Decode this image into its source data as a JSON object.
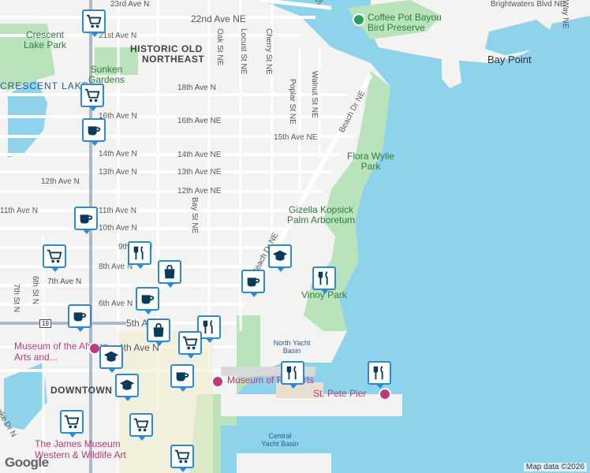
{
  "map": {
    "colors": {
      "water": "#8ed3ec",
      "park": "#b9e3bb",
      "land": "#f3f3f1",
      "road": "#ffffff",
      "marker_border": "#2b8ad6",
      "poi": "#c0397d"
    },
    "districts": [
      "HISTORIC OLD",
      "NORTHEAST",
      "DOWNTOWN"
    ],
    "parks": [
      "Crescent Lake Park",
      "Sunken Gardens",
      "Flora Wylie Park",
      "Gizella Kopsick Palm Arboretum",
      "Vinoy Park",
      "Coffee Pot Bayou Bird Preserve"
    ],
    "water": [
      "CRESCENT LAKE",
      "North Yacht Basin",
      "Central Yacht Basin"
    ],
    "places": [
      "Bay Point",
      "Museum of the African Arts and...",
      "Museum of Fine Arts",
      "St. Pete Pier",
      "The James Museum Western & Wildlife Art"
    ],
    "roads": {
      "horizontal": [
        "23rd Ave N",
        "22nd Ave NE",
        "21st Ave N",
        "18th Ave N",
        "16th Ave N",
        "16th Ave NE",
        "15th Ave NE",
        "14th Ave N",
        "14th Ave NE",
        "13th Ave N",
        "13th Ave NE",
        "12th Ave N",
        "12th Ave NE",
        "11th Ave N",
        "10th Ave N",
        "9th Ave N",
        "8th Ave N",
        "7th Ave N",
        "6th Ave N",
        "5th Ave N",
        "4th Ave N"
      ],
      "vertical": [
        "Oak St NE",
        "Locust St NE",
        "Cherry St NE",
        "Poplar St NE",
        "Walnut St NE",
        "Bay St NE",
        "6th St N",
        "7th St N"
      ],
      "other": [
        "Beach Dr NE",
        "Snell Isle Blvd NE",
        "Brightwaters Blvd NE",
        "Beach Dr NE",
        "19",
        "Lake Dr N",
        "Way NE"
      ]
    },
    "markers": [
      {
        "icon": "cart-icon"
      },
      {
        "icon": "cart-icon"
      },
      {
        "icon": "coffee-icon"
      },
      {
        "icon": "coffee-icon"
      },
      {
        "icon": "cart-icon"
      },
      {
        "icon": "restaurant-icon"
      },
      {
        "icon": "shopping-bag-icon"
      },
      {
        "icon": "graduation-cap-icon"
      },
      {
        "icon": "coffee-icon"
      },
      {
        "icon": "restaurant-icon"
      },
      {
        "icon": "coffee-icon"
      },
      {
        "icon": "coffee-icon"
      },
      {
        "icon": "shopping-bag-icon"
      },
      {
        "icon": "restaurant-icon"
      },
      {
        "icon": "restaurant-icon"
      },
      {
        "icon": "restaurant-icon"
      }
    ],
    "attribution": "Map data ©2026",
    "logo": "Google"
  }
}
